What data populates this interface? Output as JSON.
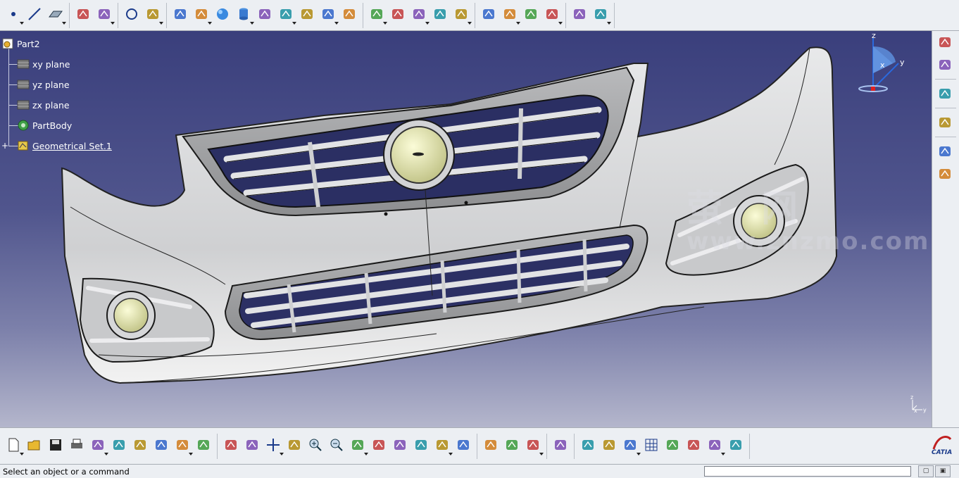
{
  "app": {
    "name": "CATIA",
    "logo_text": "CATIA"
  },
  "tree": {
    "root": "Part2",
    "items": [
      {
        "label": "xy plane",
        "icon": "plane-icon"
      },
      {
        "label": "yz plane",
        "icon": "plane-icon"
      },
      {
        "label": "zx plane",
        "icon": "plane-icon"
      },
      {
        "label": "PartBody",
        "icon": "gear-body-icon"
      },
      {
        "label": "Geometrical Set.1",
        "icon": "geometrical-set-icon"
      }
    ]
  },
  "compass_axes": {
    "x": "x",
    "y": "y",
    "z": "z"
  },
  "mini_axes": {
    "z": "z",
    "x": "x",
    "y": "y"
  },
  "watermark": {
    "cn": "萤 网",
    "url": "www.znzmo.com"
  },
  "status": {
    "text": "Select an object or a command",
    "command_value": ""
  },
  "colors": {
    "viewport_top": "#3a3f7c",
    "viewport_bottom": "#b4b6cc",
    "part_surface": "#d9dadc",
    "lamp": "#e6e8b0",
    "tree_text": "#ffffff"
  },
  "top_toolbar_groups": [
    [
      "point-icon",
      "line-icon",
      "plane-icon"
    ],
    [
      "projection-icon",
      "intersection-icon"
    ],
    [
      "circle-icon",
      "spline-icon"
    ],
    [
      "extrude-icon",
      "revolve-icon",
      "sphere-icon",
      "cylinder-icon",
      "offset-icon",
      "sweep-icon",
      "fill-icon",
      "multi-section-icon",
      "blend-icon"
    ],
    [
      "join-icon",
      "healing-icon",
      "split-icon",
      "trim-icon",
      "boundary-icon"
    ],
    [
      "fillet-icon",
      "translate-icon",
      "measure-icon",
      "analysis-icon"
    ],
    [
      "update-icon",
      "design-table-icon"
    ]
  ],
  "bottom_toolbar_groups": [
    [
      "new-file-icon",
      "open-file-icon",
      "save-icon",
      "print-icon",
      "cut-icon",
      "copy-icon",
      "paste-icon",
      "undo-icon",
      "redo-icon",
      "whats-this-icon"
    ],
    [
      "fly-mode-icon",
      "fit-all-icon",
      "pan-icon",
      "rotate-icon",
      "zoom-in-icon",
      "zoom-out-icon",
      "normal-view-icon",
      "multi-view-icon",
      "iso-view-icon",
      "shading-icon",
      "hide-show-icon",
      "swap-visible-space-icon"
    ],
    [
      "measure-between-icon",
      "measure-item-icon",
      "mass-properties-icon"
    ],
    [
      "capture-icon"
    ],
    [
      "3dx-icon",
      "touch-icon",
      "axis-system-icon",
      "grid-icon",
      "work-on-support-icon",
      "snap-icon",
      "material-icon",
      "catalog-icon"
    ]
  ],
  "right_toolbar": [
    "sketcher-icon",
    "select-icon",
    "more-arrow-icon",
    "sketch-edit-icon",
    "knowledge-icon",
    "formula-icon"
  ]
}
